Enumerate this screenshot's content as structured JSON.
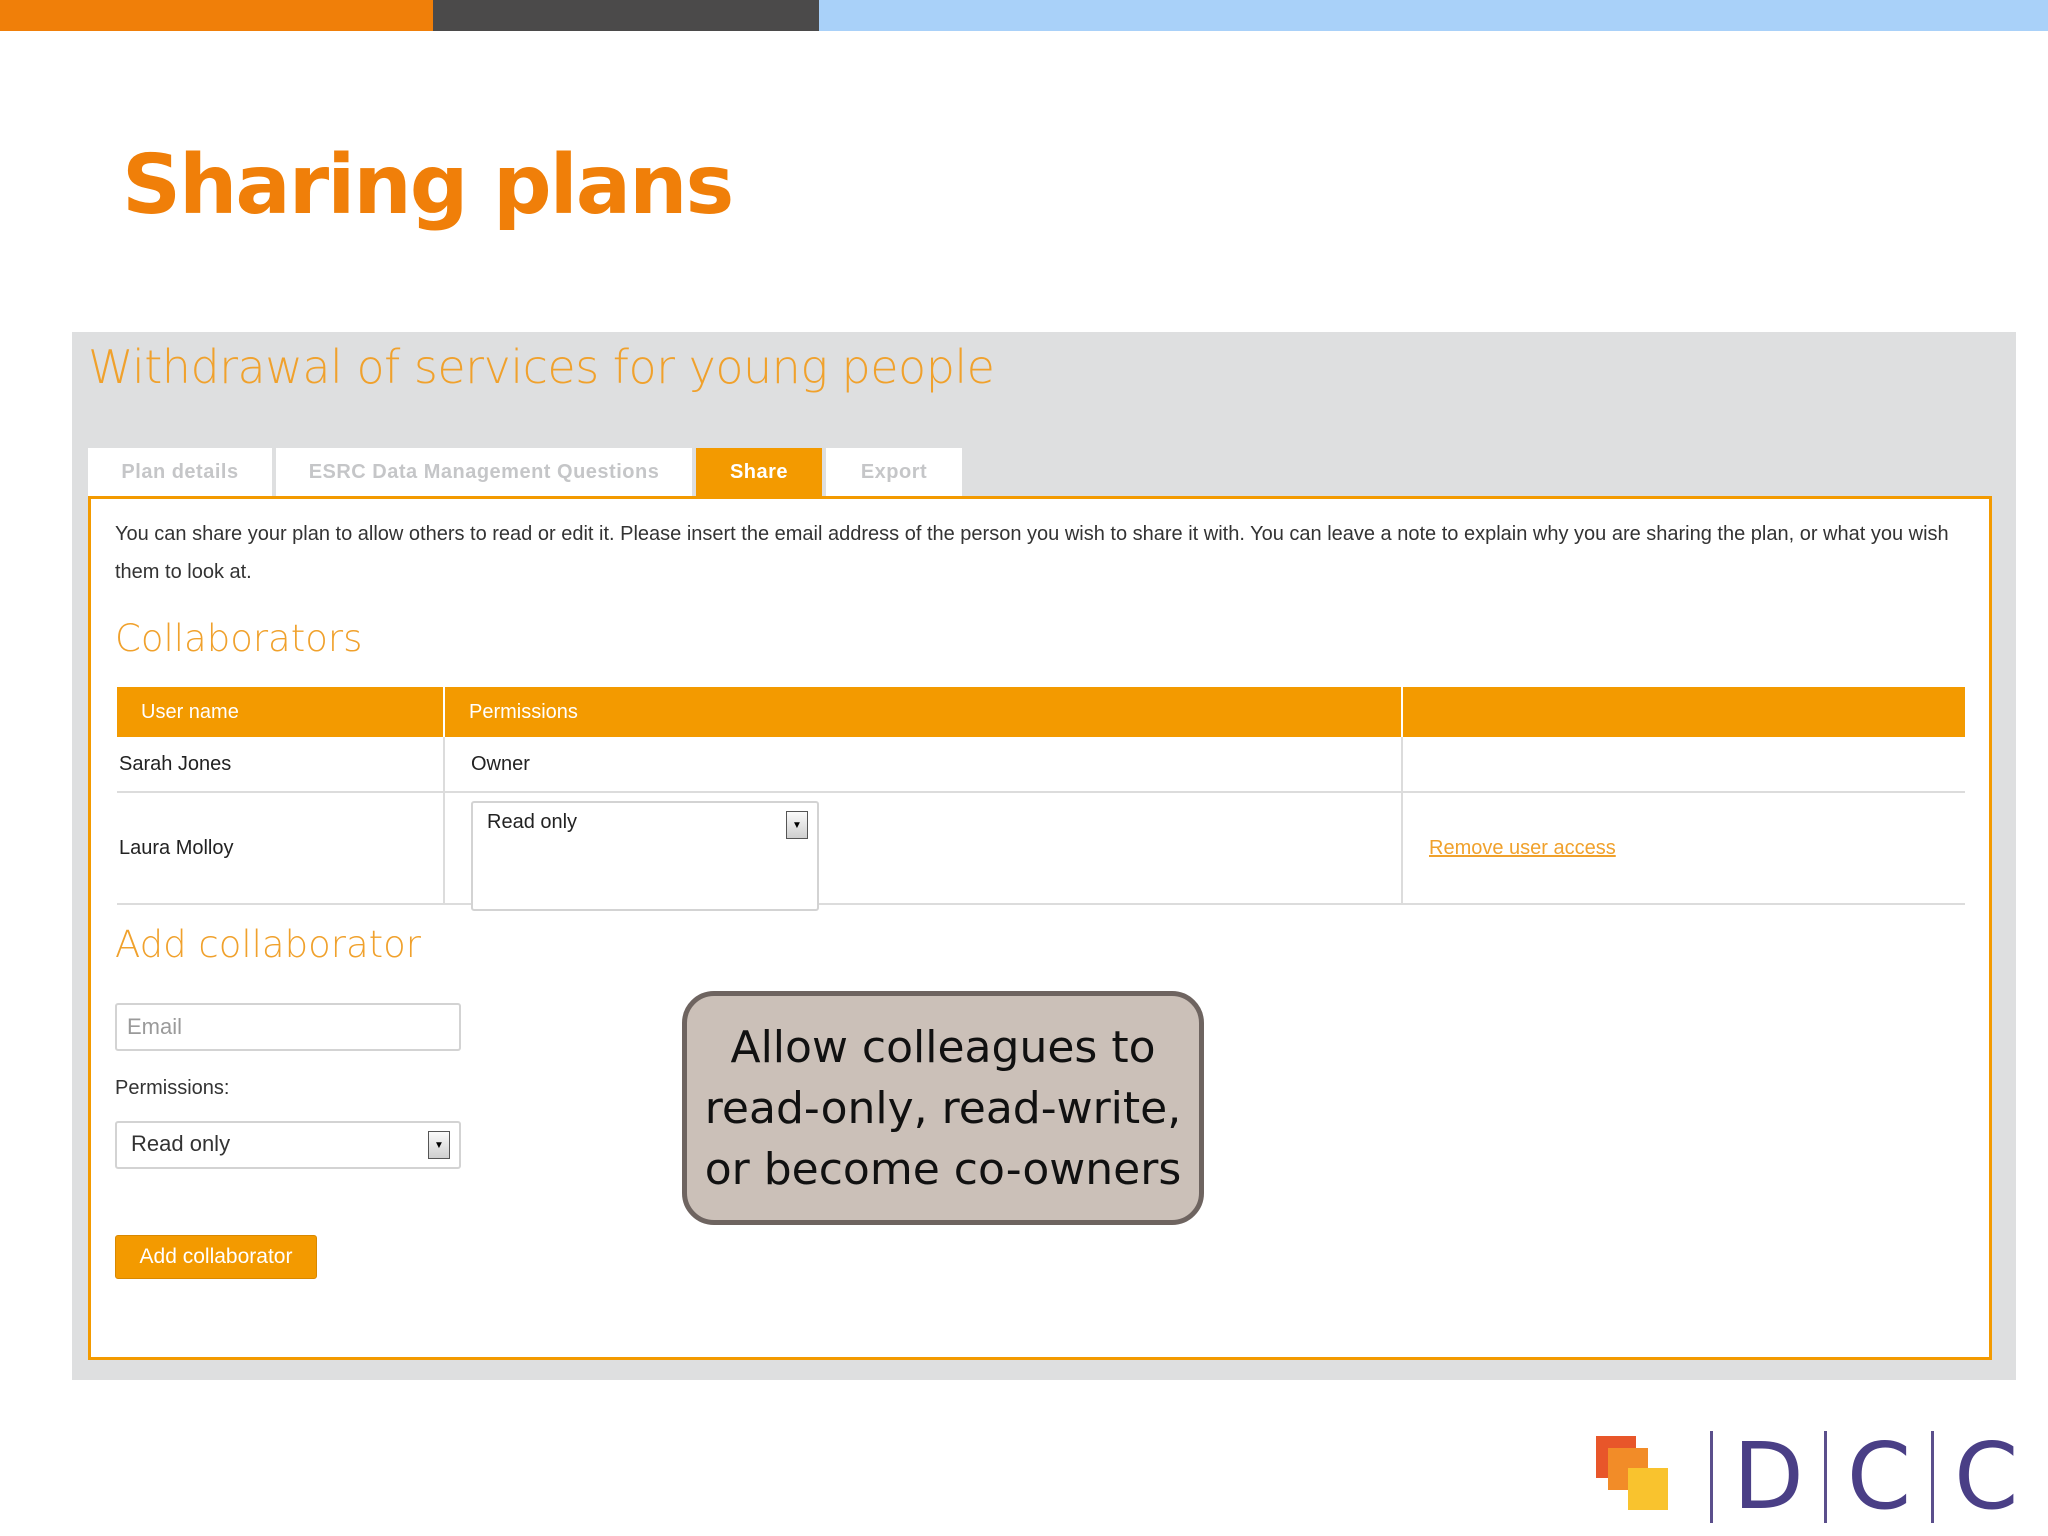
{
  "slide": {
    "title": "Sharing plans"
  },
  "plan": {
    "title": "Withdrawal of services for young people",
    "tabs": [
      {
        "label": "Plan details",
        "active": false
      },
      {
        "label": "ESRC Data Management Questions",
        "active": false
      },
      {
        "label": "Share",
        "active": true
      },
      {
        "label": "Export",
        "active": false
      }
    ],
    "intro": "You can share your plan to allow others to read or edit it. Please insert the email address of the person you wish to share it with. You can leave a note to explain why you are sharing the plan, or what you wish them to look at."
  },
  "collaborators": {
    "heading": "Collaborators",
    "columns": [
      "User name",
      "Permissions",
      ""
    ],
    "rows": [
      {
        "user": "Sarah Jones",
        "permission": "Owner",
        "action": ""
      },
      {
        "user": "Laura Molloy",
        "permission": "Read only",
        "action": "Remove user access"
      }
    ]
  },
  "add_collaborator": {
    "heading": "Add collaborator",
    "email_placeholder": "Email",
    "permissions_label": "Permissions:",
    "permission_selected": "Read only",
    "button_label": "Add collaborator"
  },
  "callout": {
    "text": "Allow colleagues to read-only, read-write, or become co-owners"
  },
  "logo": {
    "letters": [
      "D",
      "C",
      "C"
    ]
  },
  "colors": {
    "accent_orange": "#f39a00",
    "title_orange": "#f07f09",
    "strip_gray": "#4b4a4a",
    "strip_blue": "#a9d1f9",
    "logo_purple": "#4a3f86"
  },
  "icons": {
    "select_arrow": "chevron-down-icon",
    "logo_mark": "stacked-squares-logo"
  }
}
